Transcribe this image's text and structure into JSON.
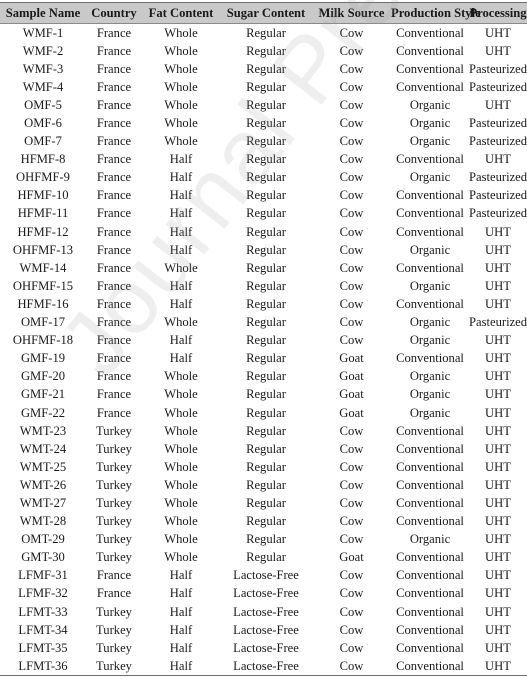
{
  "watermark": "Journal Pre-proof",
  "table": {
    "headers": [
      "Sample Name",
      "Country",
      "Fat Content",
      "Sugar Content",
      "Milk Source",
      "Production Style",
      "Processing"
    ],
    "rows": [
      [
        "WMF-1",
        "France",
        "Whole",
        "Regular",
        "Cow",
        "Conventional",
        "UHT"
      ],
      [
        "WMF-2",
        "France",
        "Whole",
        "Regular",
        "Cow",
        "Conventional",
        "UHT"
      ],
      [
        "WMF-3",
        "France",
        "Whole",
        "Regular",
        "Cow",
        "Conventional",
        "Pasteurized"
      ],
      [
        "WMF-4",
        "France",
        "Whole",
        "Regular",
        "Cow",
        "Conventional",
        "Pasteurized"
      ],
      [
        "OMF-5",
        "France",
        "Whole",
        "Regular",
        "Cow",
        "Organic",
        "UHT"
      ],
      [
        "OMF-6",
        "France",
        "Whole",
        "Regular",
        "Cow",
        "Organic",
        "Pasteurized"
      ],
      [
        "OMF-7",
        "France",
        "Whole",
        "Regular",
        "Cow",
        "Organic",
        "Pasteurized"
      ],
      [
        "HFMF-8",
        "France",
        "Half",
        "Regular",
        "Cow",
        "Conventional",
        "UHT"
      ],
      [
        "OHFMF-9",
        "France",
        "Half",
        "Regular",
        "Cow",
        "Organic",
        "Pasteurized"
      ],
      [
        "HFMF-10",
        "France",
        "Half",
        "Regular",
        "Cow",
        "Conventional",
        "Pasteurized"
      ],
      [
        "HFMF-11",
        "France",
        "Half",
        "Regular",
        "Cow",
        "Conventional",
        "Pasteurized"
      ],
      [
        "HFMF-12",
        "France",
        "Half",
        "Regular",
        "Cow",
        "Conventional",
        "UHT"
      ],
      [
        "OHFMF-13",
        "France",
        "Half",
        "Regular",
        "Cow",
        "Organic",
        "UHT"
      ],
      [
        "WMF-14",
        "France",
        "Whole",
        "Regular",
        "Cow",
        "Conventional",
        "UHT"
      ],
      [
        "OHFMF-15",
        "France",
        "Half",
        "Regular",
        "Cow",
        "Organic",
        "UHT"
      ],
      [
        "HFMF-16",
        "France",
        "Half",
        "Regular",
        "Cow",
        "Conventional",
        "UHT"
      ],
      [
        "OMF-17",
        "France",
        "Whole",
        "Regular",
        "Cow",
        "Organic",
        "Pasteurized"
      ],
      [
        "OHFMF-18",
        "France",
        "Half",
        "Regular",
        "Cow",
        "Organic",
        "UHT"
      ],
      [
        "GMF-19",
        "France",
        "Half",
        "Regular",
        "Goat",
        "Conventional",
        "UHT"
      ],
      [
        "GMF-20",
        "France",
        "Whole",
        "Regular",
        "Goat",
        "Organic",
        "UHT"
      ],
      [
        "GMF-21",
        "France",
        "Whole",
        "Regular",
        "Goat",
        "Organic",
        "UHT"
      ],
      [
        "GMF-22",
        "France",
        "Whole",
        "Regular",
        "Goat",
        "Organic",
        "UHT"
      ],
      [
        "WMT-23",
        "Turkey",
        "Whole",
        "Regular",
        "Cow",
        "Conventional",
        "UHT"
      ],
      [
        "WMT-24",
        "Turkey",
        "Whole",
        "Regular",
        "Cow",
        "Conventional",
        "UHT"
      ],
      [
        "WMT-25",
        "Turkey",
        "Whole",
        "Regular",
        "Cow",
        "Conventional",
        "UHT"
      ],
      [
        "WMT-26",
        "Turkey",
        "Whole",
        "Regular",
        "Cow",
        "Conventional",
        "UHT"
      ],
      [
        "WMT-27",
        "Turkey",
        "Whole",
        "Regular",
        "Cow",
        "Conventional",
        "UHT"
      ],
      [
        "WMT-28",
        "Turkey",
        "Whole",
        "Regular",
        "Cow",
        "Conventional",
        "UHT"
      ],
      [
        "OMT-29",
        "Turkey",
        "Whole",
        "Regular",
        "Cow",
        "Organic",
        "UHT"
      ],
      [
        "GMT-30",
        "Turkey",
        "Whole",
        "Regular",
        "Goat",
        "Conventional",
        "UHT"
      ],
      [
        "LFMF-31",
        "France",
        "Half",
        "Lactose-Free",
        "Cow",
        "Conventional",
        "UHT"
      ],
      [
        "LFMF-32",
        "France",
        "Half",
        "Lactose-Free",
        "Cow",
        "Conventional",
        "UHT"
      ],
      [
        "LFMT-33",
        "Turkey",
        "Half",
        "Lactose-Free",
        "Cow",
        "Conventional",
        "UHT"
      ],
      [
        "LFMT-34",
        "Turkey",
        "Half",
        "Lactose-Free",
        "Cow",
        "Conventional",
        "UHT"
      ],
      [
        "LFMT-35",
        "Turkey",
        "Half",
        "Lactose-Free",
        "Cow",
        "Conventional",
        "UHT"
      ],
      [
        "LFMT-36",
        "Turkey",
        "Half",
        "Lactose-Free",
        "Cow",
        "Conventional",
        "UHT"
      ]
    ]
  },
  "colors": {
    "header_background": "#c9c9c9",
    "rule_line": "#6e6e6e",
    "text": "#1a1a1a"
  }
}
